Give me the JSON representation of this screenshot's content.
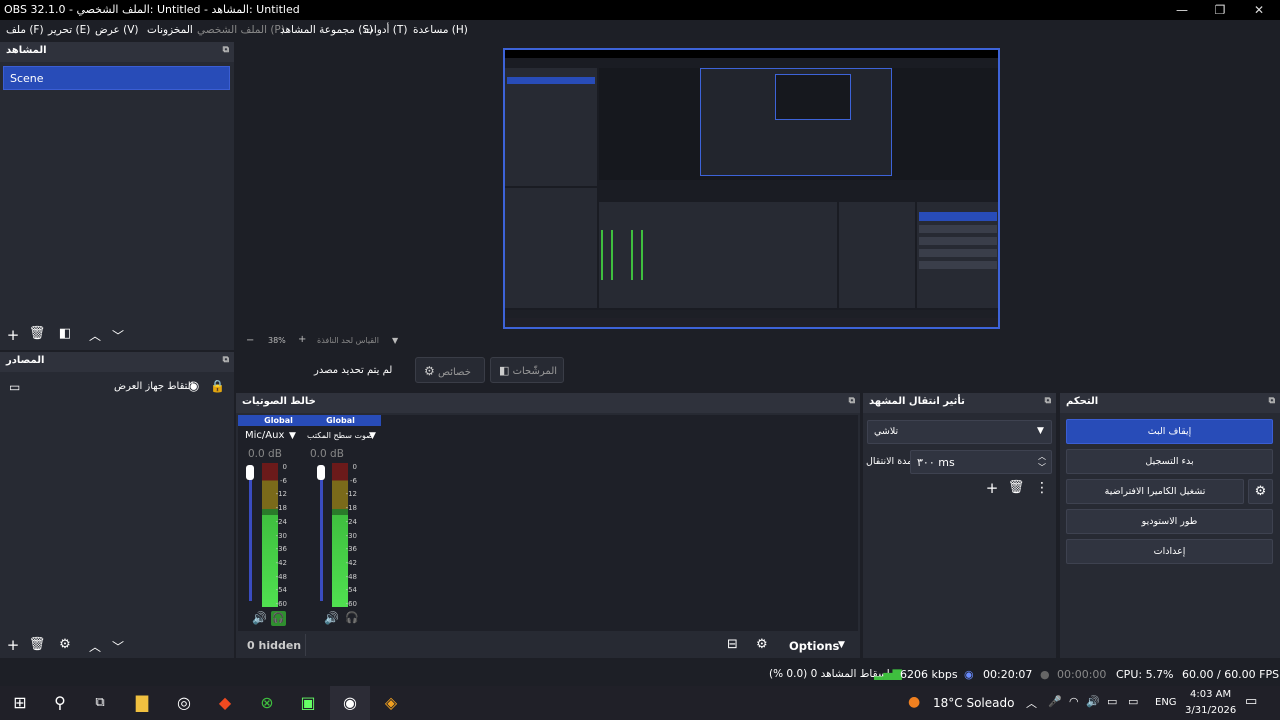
{
  "window": {
    "title": "OBS 32.1.0 - الملف الشخصي: Untitled - المشاهد: Untitled"
  },
  "menu": [
    "ملف (F)",
    "تحرير (E)",
    "عرض (V)",
    "المخزونات",
    "الملف الشخصي (P)",
    "مجموعة المشاهد (S)",
    "أدوات (T)",
    "مساعدة (H)"
  ],
  "scenes": {
    "title": "المشاهد",
    "items": [
      "Scene"
    ]
  },
  "sources": {
    "title": "المصادر",
    "items": [
      {
        "name": "التقاط جهاز العرض"
      }
    ]
  },
  "zoom": {
    "value": "38%",
    "label": "القياس لحد النافذة"
  },
  "context": {
    "no_source": "لم يتم تحديد مصدر",
    "properties": "خصائص",
    "filters": "المرشّحات"
  },
  "mixer": {
    "title": "خالط الصوتيات",
    "channels": [
      {
        "scope": "Global",
        "name": "Mic/Aux",
        "db": "0.0 dB"
      },
      {
        "scope": "Global",
        "name": "صوت سطح المكتب",
        "db": "0.0 dB"
      }
    ],
    "ticks": [
      "0",
      "-6",
      "-12",
      "-18",
      "-24",
      "-30",
      "-36",
      "-42",
      "-48",
      "-54",
      "-60"
    ],
    "hidden": "0 hidden",
    "options": "Options"
  },
  "transitions": {
    "title": "تأثير انتقال المشهد",
    "type": "تلاشي",
    "duration_label": "مدة الانتقال",
    "duration": "٣٠٠ ms"
  },
  "controls": {
    "title": "التحكم",
    "buttons": [
      "إيقاف البث",
      "بدء التسجيل",
      "تشغيل الكاميرا الافتراضية",
      "طور الاستوديو",
      "إعدادات"
    ]
  },
  "status": {
    "dropped": "إسقاط المشاهد 0 (0.0 %)",
    "bitrate": "6206 kbps",
    "stream_time": "00:20:07",
    "rec_time": "00:00:00",
    "cpu": "CPU: 5.7%",
    "fps": "60.00 / 60.00 FPS"
  },
  "taskbar": {
    "weather": "18°C  Soleado",
    "lang": "ENG",
    "time": "4:03 AM",
    "date": "3/31/2026"
  },
  "colors": {
    "accent": "#284cb8",
    "bg": "#1d1f26",
    "panel": "#272a33"
  }
}
